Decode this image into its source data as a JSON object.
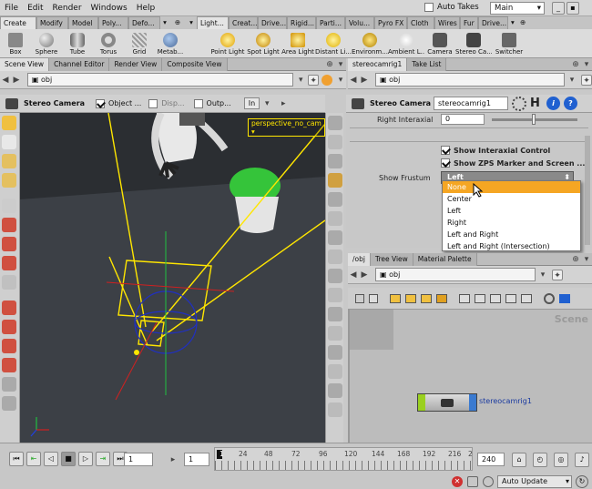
{
  "menubar": {
    "items": [
      "File",
      "Edit",
      "Render",
      "Windows",
      "Help"
    ],
    "auto_takes": "Auto Takes",
    "take": "Main"
  },
  "shelf": {
    "left_tabs": [
      "Create",
      "Modify",
      "Model",
      "Poly...",
      "Defo..."
    ],
    "right_tabs": [
      "Light...",
      "Creat...",
      "Drive...",
      "Rigid...",
      "Parti...",
      "Volu...",
      "Pyro FX",
      "Cloth",
      "Wires",
      "Fur",
      "Drive..."
    ],
    "left_tools": [
      {
        "label": "Box",
        "icon": "box-icon"
      },
      {
        "label": "Sphere",
        "icon": "sphere-icon"
      },
      {
        "label": "Tube",
        "icon": "tube-icon"
      },
      {
        "label": "Torus",
        "icon": "torus-icon"
      },
      {
        "label": "Grid",
        "icon": "grid-icon"
      },
      {
        "label": "Metab...",
        "icon": "metaball-icon"
      }
    ],
    "right_tools": [
      {
        "label": "Point Light",
        "icon": "point-light-icon"
      },
      {
        "label": "Spot Light",
        "icon": "spot-light-icon"
      },
      {
        "label": "Area Light",
        "icon": "area-light-icon"
      },
      {
        "label": "Distant Li...",
        "icon": "distant-light-icon"
      },
      {
        "label": "Environm...",
        "icon": "environment-light-icon"
      },
      {
        "label": "Ambient L...",
        "icon": "ambient-light-icon"
      },
      {
        "label": "Camera",
        "icon": "camera-icon"
      },
      {
        "label": "Stereo Ca...",
        "icon": "stereo-camera-icon"
      },
      {
        "label": "Switcher",
        "icon": "switcher-icon"
      }
    ]
  },
  "left_pane": {
    "tabs": [
      "Scene View",
      "Channel Editor",
      "Render View",
      "Composite View"
    ],
    "path": "obj",
    "toolbar": {
      "title": "Stereo Camera",
      "object_label": "Object ...",
      "disp_label": "Disp...",
      "outp_label": "Outp...",
      "in_label": "In"
    },
    "camera_label": "perspective_no_cam"
  },
  "param_pane": {
    "tabs": [
      "stereocamrig1",
      "Take List"
    ],
    "node_type": "Stereo Camera",
    "node_name": "stereocamrig1",
    "right_interaxial_label": "Right Interaxial",
    "right_interaxial_value": "0",
    "show_interaxial": "Show Interaxial Control",
    "show_zps": "Show ZPS Marker and Screen ...",
    "show_frustum_label": "Show Frustum",
    "show_frustum_value": "Left",
    "frustum_options": [
      "None",
      "Center",
      "Left",
      "Right",
      "Left and Right",
      "Left and Right (Intersection)"
    ],
    "frustum_highlight": "None"
  },
  "network_pane": {
    "tabs": [
      "/obj",
      "Tree View",
      "Material Palette"
    ],
    "path": "obj",
    "watermark": "Scene",
    "node_label": "stereocamrig1"
  },
  "timeline": {
    "start_frame": "1",
    "current_frame": "1",
    "end_frame": "240",
    "ticks": [
      "1",
      "24",
      "48",
      "72",
      "96",
      "120",
      "144",
      "168",
      "192",
      "216",
      "2"
    ],
    "update_mode": "Auto Update"
  },
  "colors": {
    "accent": "#f5a623",
    "viewport_yellow": "#ffe600",
    "select_orange": "#f5a623"
  }
}
